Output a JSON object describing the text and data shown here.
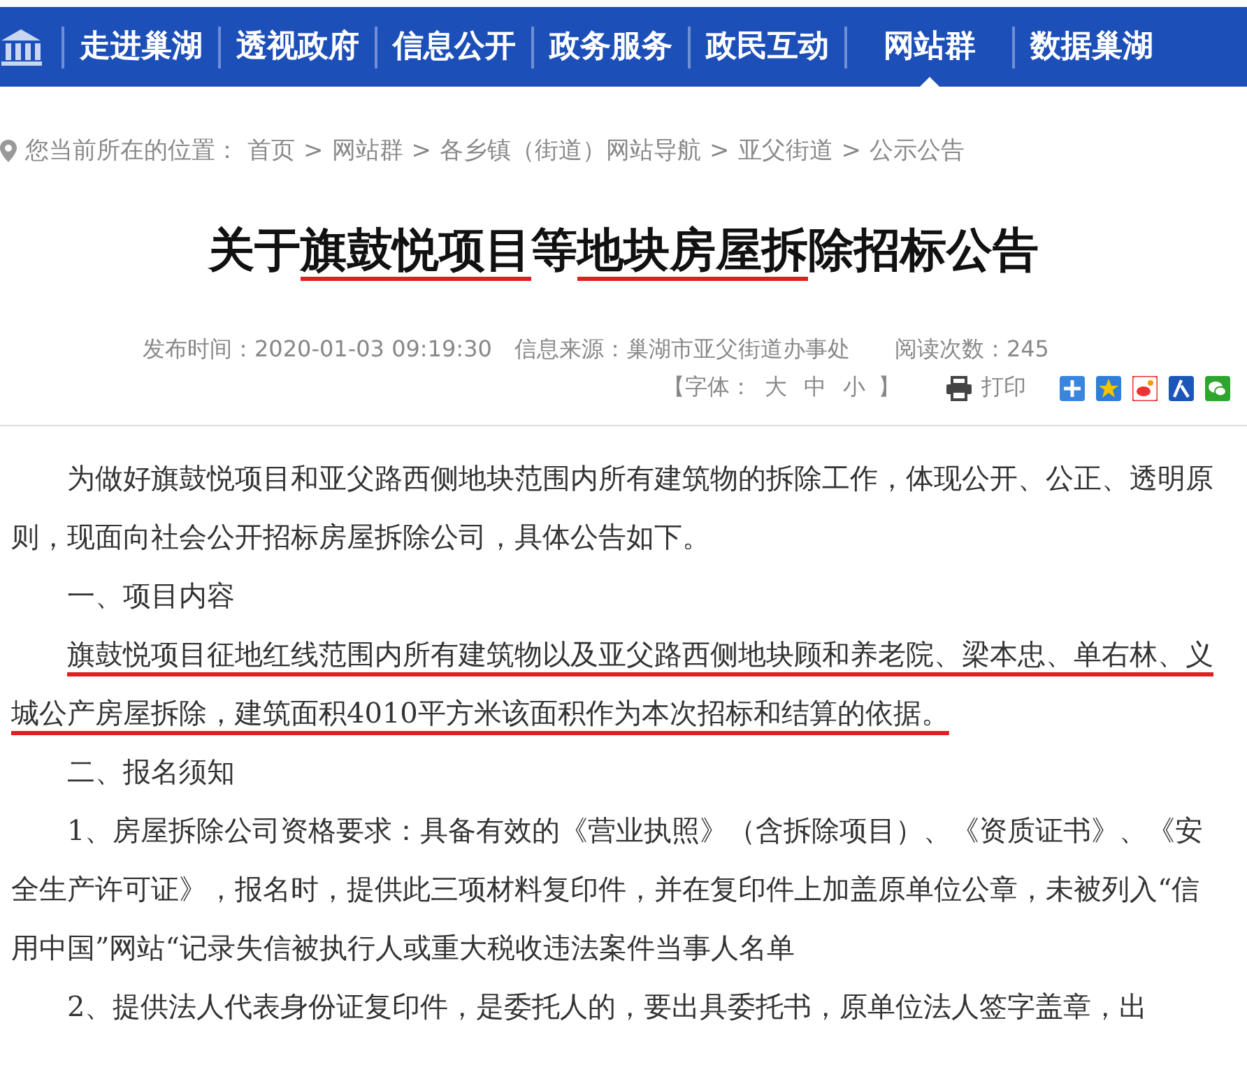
{
  "nav": {
    "items": [
      {
        "label": "走进巢湖",
        "selected": false
      },
      {
        "label": "透视政府",
        "selected": false
      },
      {
        "label": "信息公开",
        "selected": false
      },
      {
        "label": "政务服务",
        "selected": false
      },
      {
        "label": "政民互动",
        "selected": false
      },
      {
        "label": "网站群",
        "selected": true
      },
      {
        "label": "数据巢湖",
        "selected": false
      }
    ]
  },
  "breadcrumb": {
    "prefix": "您当前所在的位置：",
    "items": [
      "首页",
      "网站群",
      "各乡镇（街道）网站导航",
      "亚父街道",
      "公示公告"
    ],
    "separator": ">"
  },
  "article": {
    "title": [
      {
        "text": "关于",
        "underlined": false
      },
      {
        "text": "旗鼓悦项目",
        "underlined": true
      },
      {
        "text": "等",
        "underlined": false
      },
      {
        "text": "地块房屋拆",
        "underlined": true
      },
      {
        "text": "除招标公告",
        "underlined": false
      }
    ],
    "meta": [
      "发布时间：2020-01-03 09:19:30",
      "信息来源：巢湖市亚父街道办事处",
      "阅读次数：245"
    ],
    "font_size": {
      "open": "【字体：",
      "sizes": [
        "大",
        "中",
        "小"
      ],
      "close": "】"
    },
    "print": "打印",
    "paragraphs": [
      {
        "text": "为做好旗鼓悦项目和亚父路西侧地块范围内所有建筑物的拆除工作，体现公开、公正、透明原则，现面向社会公开招标房屋拆除公司，具体公告如下。",
        "underlined": false
      },
      {
        "text": "一、项目内容",
        "underlined": false
      },
      {
        "text": "旗鼓悦项目征地红线范围内所有建筑物以及亚父路西侧地块顾和养老院、梁本忠、单右林、义城公产房屋拆除，建筑面积4010平方米该面积作为本次招标和结算的依据。",
        "underlined": true
      },
      {
        "text": "二、报名须知",
        "underlined": false
      },
      {
        "text": "1、房屋拆除公司资格要求：具备有效的《营业执照》（含拆除项目）、《资质证书》、《安全生产许可证》，报名时，提供此三项材料复印件，并在复印件上加盖原单位公章，未被列入“信用中国”网站“记录失信被执行人或重大税收违法案件当事人名单",
        "underlined": false
      },
      {
        "text": "2、提供法人代表身份证复印件，是委托人的，要出具委托书，原单位法人签字盖章，出",
        "underlined": false
      }
    ]
  }
}
